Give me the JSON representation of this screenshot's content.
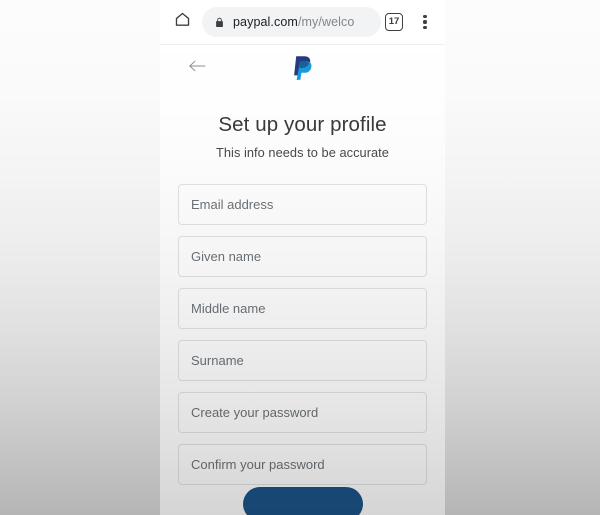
{
  "browser": {
    "home_icon": "home-icon",
    "lock_icon": "lock-icon",
    "url_secure_part": "paypal.com",
    "url_path_part": "/my/welco",
    "tab_count": "17",
    "menu_icon": "kebab-menu-icon"
  },
  "page": {
    "back_icon": "back-arrow-icon",
    "logo_name": "paypal-logo",
    "title": "Set up your profile",
    "subtitle": "This info needs to be accurate",
    "fields": [
      {
        "name": "email-address-field",
        "placeholder": "Email address",
        "value": "",
        "type": "text"
      },
      {
        "name": "given-name-field",
        "placeholder": "Given name",
        "value": "",
        "type": "text"
      },
      {
        "name": "middle-name-field",
        "placeholder": "Middle name",
        "value": "",
        "type": "text"
      },
      {
        "name": "surname-field",
        "placeholder": "Surname",
        "value": "",
        "type": "text"
      },
      {
        "name": "create-password-field",
        "placeholder": "Create your password",
        "value": "",
        "type": "password"
      },
      {
        "name": "confirm-password-field",
        "placeholder": "Confirm your password",
        "value": "",
        "type": "password"
      }
    ],
    "cta_label": ""
  },
  "colors": {
    "paypal_dark_blue": "#253B80",
    "paypal_light_blue": "#179BD7",
    "cta_blue": "#1b5488",
    "field_border": "#e2e3e5",
    "omnibox_bg": "#f1f3f4"
  }
}
